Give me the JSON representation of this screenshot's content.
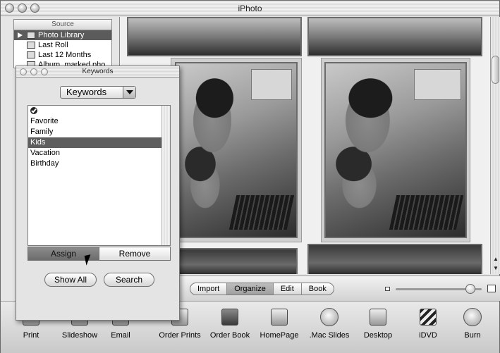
{
  "window": {
    "title": "iPhoto"
  },
  "source": {
    "header": "Source",
    "items": [
      {
        "label": "Photo Library",
        "selected": true,
        "icon": "library-icon"
      },
      {
        "label": "Last Roll",
        "selected": false,
        "icon": "film-roll-icon"
      },
      {
        "label": "Last 12 Months",
        "selected": false,
        "icon": "calendar-icon"
      },
      {
        "label": "Album, marked pho",
        "selected": false,
        "icon": "album-icon"
      }
    ]
  },
  "keywords_panel": {
    "title": "Keywords",
    "popup_value": "Keywords",
    "list": [
      {
        "label": "",
        "icon": "checkmark-icon"
      },
      {
        "label": "Favorite"
      },
      {
        "label": "Family"
      },
      {
        "label": "Kids",
        "selected": true
      },
      {
        "label": "Vacation"
      },
      {
        "label": "Birthday"
      }
    ],
    "assign_label": "Assign",
    "remove_label": "Remove",
    "show_all_label": "Show All",
    "search_label": "Search"
  },
  "mode_bar": {
    "modes": [
      "Import",
      "Organize",
      "Edit",
      "Book"
    ],
    "selected": "Organize"
  },
  "toolbar": {
    "items": [
      {
        "label": "Print",
        "icon": "printer-icon"
      },
      {
        "label": "Slideshow",
        "icon": "slideshow-icon"
      },
      {
        "label": "Email",
        "icon": "email-icon"
      },
      {
        "label": "Order Prints",
        "icon": "order-prints-icon"
      },
      {
        "label": "Order Book",
        "icon": "order-book-icon"
      },
      {
        "label": "HomePage",
        "icon": "homepage-icon"
      },
      {
        "label": ".Mac Slides",
        "icon": "mac-slides-icon"
      },
      {
        "label": "Desktop",
        "icon": "desktop-icon"
      },
      {
        "label": "iDVD",
        "icon": "idvd-icon"
      },
      {
        "label": "Burn",
        "icon": "burn-icon"
      }
    ]
  }
}
